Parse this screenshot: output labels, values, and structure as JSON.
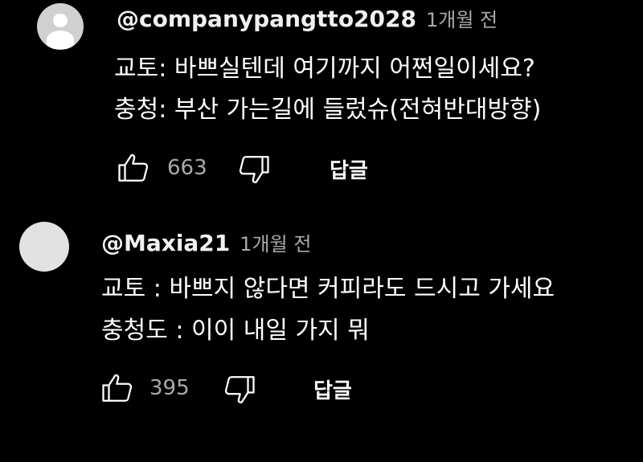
{
  "colors": {
    "background": "#000000",
    "text": "#ffffff",
    "secondary": "#aaaaaa"
  },
  "comments": [
    {
      "handle": "@companypangtto2028",
      "time": "1개월 전",
      "lines": [
        "교토: 바쁘실텐데 여기까지 어쩐일이세요?",
        "충청: 부산 가는길에 들렀슈(전혀반대방향)"
      ],
      "like_count": "663",
      "reply_label": "답글",
      "avatar_icon": "default-user-icon"
    },
    {
      "handle": "@Maxia21",
      "time": "1개월 전",
      "lines": [
        "교토 : 바쁘지 않다면 커피라도 드시고 가세요",
        "충청도 : 이이 내일 가지 뭐"
      ],
      "like_count": "395",
      "reply_label": "답글",
      "avatar_icon": "plain-avatar"
    }
  ]
}
